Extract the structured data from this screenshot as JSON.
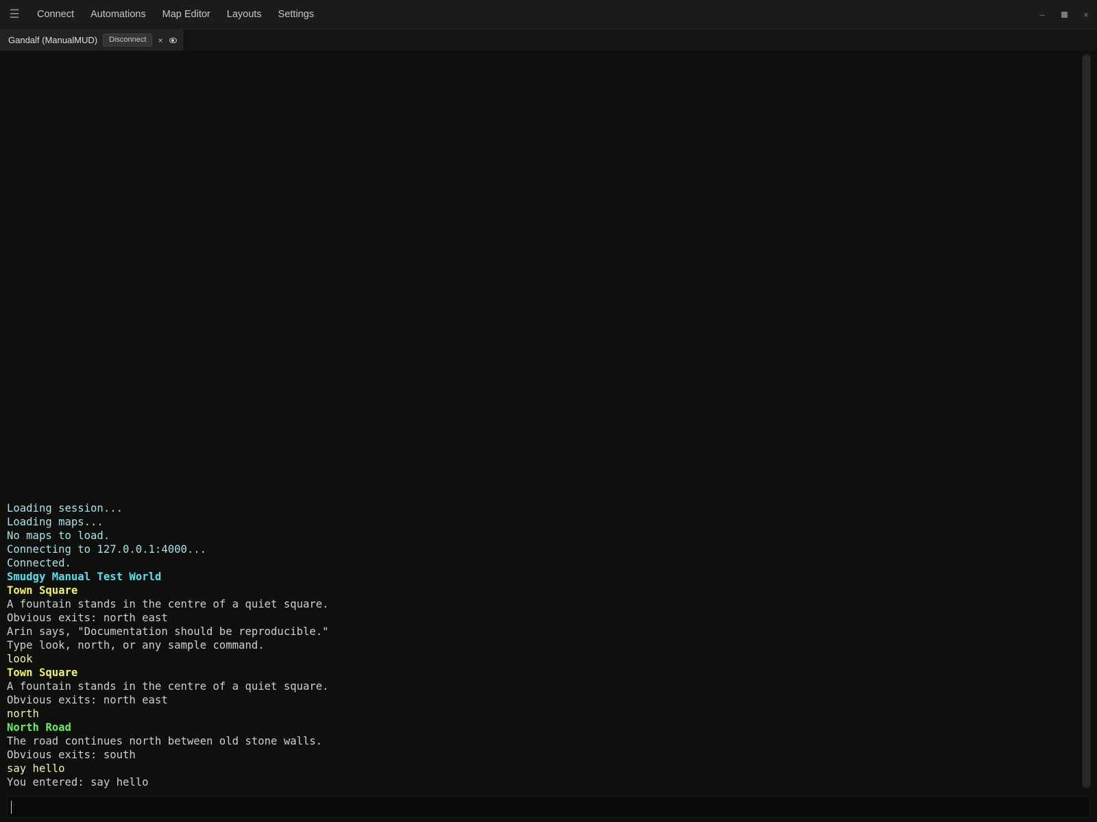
{
  "menubar": {
    "menu_icon": "hamburger-menu-icon",
    "items": [
      "Connect",
      "Automations",
      "Map Editor",
      "Layouts",
      "Settings"
    ],
    "window_controls": {
      "minimize": "–",
      "close": "×"
    }
  },
  "tab": {
    "title": "Gandalf (ManualMUD)",
    "disconnect_label": "Disconnect",
    "close_glyph": "×",
    "eye_icon": "eye-icon"
  },
  "output": {
    "lines": [
      {
        "text": "Loading session...",
        "style": "c-cyan"
      },
      {
        "text": "Loading maps...",
        "style": "c-cyan"
      },
      {
        "text": "No maps to load.",
        "style": "c-cyan"
      },
      {
        "text": "Connecting to 127.0.0.1:4000...",
        "style": "c-cyan"
      },
      {
        "text": "Connected.",
        "style": "c-cyan"
      },
      {
        "text": "Smudgy Manual Test World",
        "style": "c-bcyan"
      },
      {
        "text": "Town Square",
        "style": "c-byellow"
      },
      {
        "text": "A fountain stands in the centre of a quiet square.",
        "style": "c-default"
      },
      {
        "text": "Obvious exits: north east",
        "style": "c-default"
      },
      {
        "text": "Arin says, \"Documentation should be reproducible.\"",
        "style": "c-default"
      },
      {
        "text": "Type look, north, or any sample command.",
        "style": "c-default"
      },
      {
        "text": "look",
        "style": "c-echo"
      },
      {
        "text": "Town Square",
        "style": "c-byellow"
      },
      {
        "text": "A fountain stands in the centre of a quiet square.",
        "style": "c-default"
      },
      {
        "text": "Obvious exits: north east",
        "style": "c-default"
      },
      {
        "text": "north",
        "style": "c-echo"
      },
      {
        "text": "North Road",
        "style": "c-bgreen"
      },
      {
        "text": "The road continues north between old stone walls.",
        "style": "c-default"
      },
      {
        "text": "Obvious exits: south",
        "style": "c-default"
      },
      {
        "text": "say hello",
        "style": "c-echo"
      },
      {
        "text": "You entered: say hello",
        "style": "c-default"
      }
    ]
  },
  "input": {
    "value": "",
    "placeholder": ""
  }
}
